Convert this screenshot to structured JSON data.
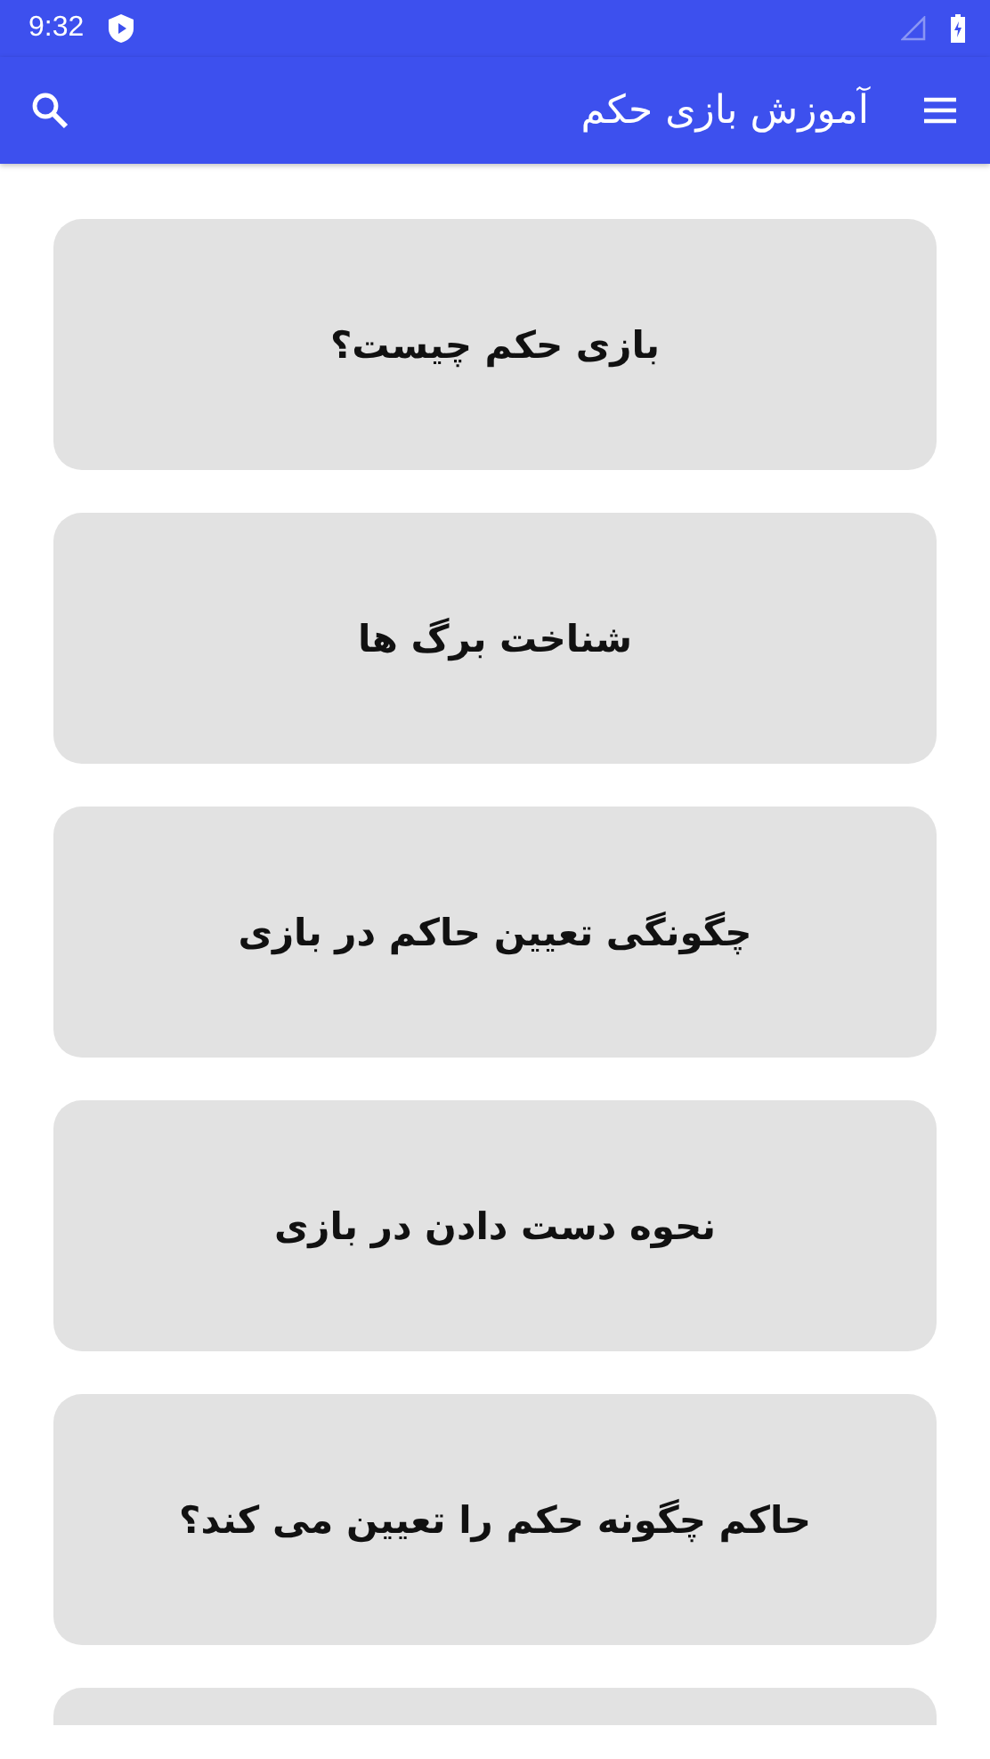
{
  "status_bar": {
    "time": "9:32"
  },
  "app_bar": {
    "title": "آموزش بازی حکم"
  },
  "lessons": [
    {
      "title": "بازی حکم چیست؟"
    },
    {
      "title": "شناخت برگ ها"
    },
    {
      "title": "چگونگی تعیین حاکم در بازی"
    },
    {
      "title": "نحوه دست دادن در بازی"
    },
    {
      "title": "حاکم چگونه حکم را تعیین می کند؟"
    }
  ],
  "more_below": true
}
